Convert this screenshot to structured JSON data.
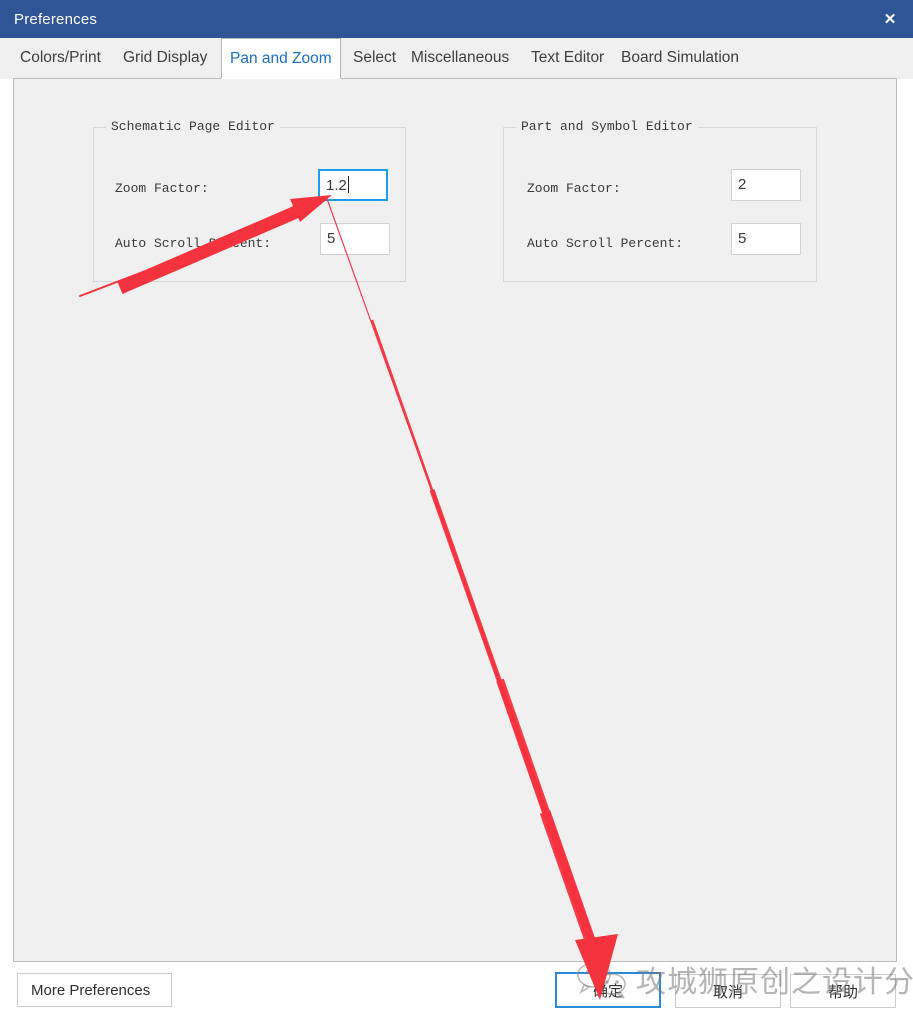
{
  "window": {
    "title": "Preferences",
    "close_icon": "close-icon",
    "title_bar_color": "#2f5597"
  },
  "tabs": [
    {
      "label": "Colors/Print",
      "active": false
    },
    {
      "label": "Grid Display",
      "active": false
    },
    {
      "label": "Pan and Zoom",
      "active": true
    },
    {
      "label": "Select",
      "active": false
    },
    {
      "label": "Miscellaneous",
      "active": false
    },
    {
      "label": "Text Editor",
      "active": false
    },
    {
      "label": "Board Simulation",
      "active": false
    }
  ],
  "groups": [
    {
      "title": "Schematic Page Editor",
      "fields": [
        {
          "label": "Zoom Factor:",
          "value": "1.2",
          "focused": true
        },
        {
          "label": "Auto Scroll Percent:",
          "value": "5",
          "focused": false
        }
      ]
    },
    {
      "title": "Part and Symbol Editor",
      "fields": [
        {
          "label": "Zoom Factor:",
          "value": "2",
          "focused": false
        },
        {
          "label": "Auto Scroll Percent:",
          "value": "5",
          "focused": false
        }
      ]
    }
  ],
  "buttons": {
    "more_preferences": "More Preferences",
    "ok": "确定",
    "cancel": "取消",
    "help": "帮助"
  },
  "watermark": {
    "text": "攻城狮原创之设计分享",
    "logo": "wechat-logo"
  },
  "annotations": {
    "accent_color": "#f5333f",
    "arrow_one_target": "zoom-factor-input",
    "arrow_two_target": "ok-button"
  }
}
